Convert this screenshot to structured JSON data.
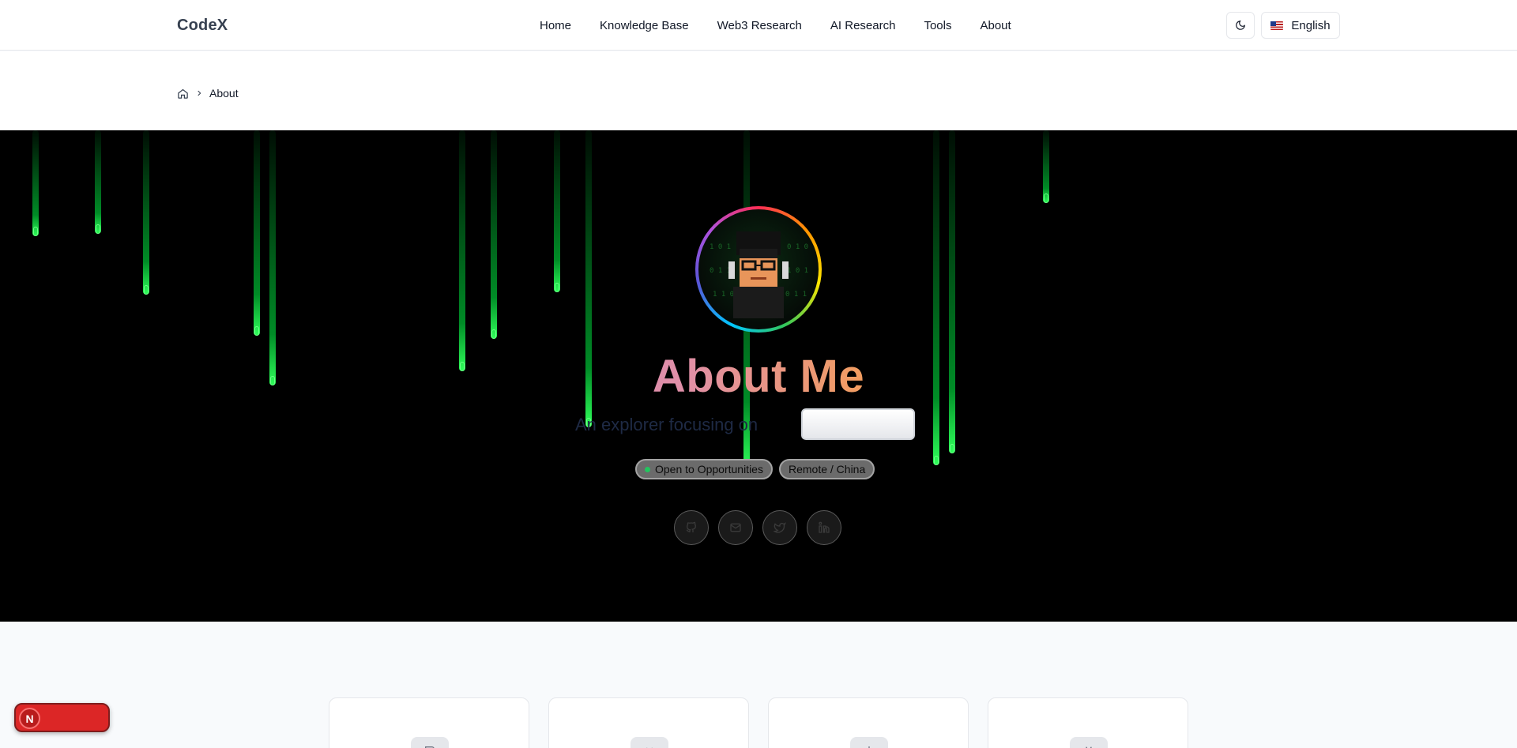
{
  "header": {
    "logo": "CodeX",
    "nav": [
      {
        "label": "Home"
      },
      {
        "label": "Knowledge Base"
      },
      {
        "label": "Web3 Research"
      },
      {
        "label": "AI Research"
      },
      {
        "label": "Tools"
      },
      {
        "label": "About"
      }
    ],
    "theme_icon": "moon-icon",
    "language": {
      "label": "English",
      "flag_icon": "us-flag-icon"
    }
  },
  "breadcrumb": {
    "home_icon": "home-icon",
    "separator_icon": "chevron-right-icon",
    "current": "About"
  },
  "hero": {
    "background_color": "#000000",
    "rain_color": "#00ff46",
    "avatar_alt": "pixel-art avatar",
    "title": "About Me",
    "typing_text": "An explorer focusing on",
    "badges": [
      {
        "label": "Open to Opportunities",
        "status_color": "#22c55e"
      },
      {
        "label": "Remote / China"
      }
    ],
    "socials": [
      {
        "icon": "github-icon"
      },
      {
        "icon": "mail-icon"
      },
      {
        "icon": "twitter-icon"
      },
      {
        "icon": "linkedin-icon"
      }
    ]
  },
  "cards": [
    {
      "icon": "book-icon"
    },
    {
      "icon": "code-icon"
    },
    {
      "icon": "chart-icon"
    },
    {
      "icon": "tools-icon"
    }
  ],
  "floating_toggle": {
    "initial": "N",
    "color": "#dc2626"
  }
}
